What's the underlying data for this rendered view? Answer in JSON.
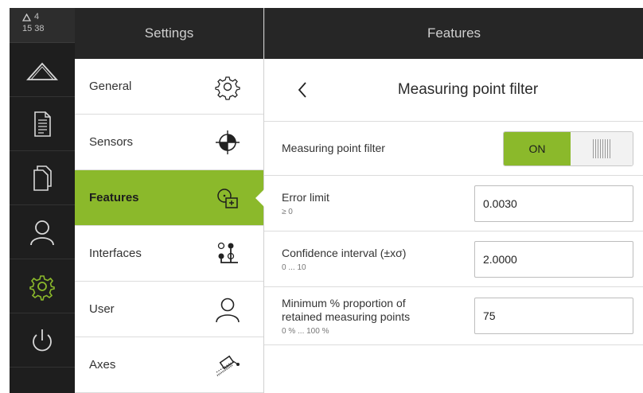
{
  "status": {
    "warning_count": "4",
    "time": "15 38"
  },
  "rail": {
    "items": [
      {
        "icon": "measure-icon"
      },
      {
        "icon": "protocol-icon"
      },
      {
        "icon": "file-management-icon"
      },
      {
        "icon": "user-login-icon"
      },
      {
        "icon": "settings-icon",
        "active": true
      },
      {
        "icon": "power-icon"
      }
    ]
  },
  "settings": {
    "header": "Settings",
    "items": [
      {
        "label": "General",
        "icon": "gear-icon"
      },
      {
        "label": "Sensors",
        "icon": "crosshair-sensor-icon"
      },
      {
        "label": "Features",
        "icon": "features-icon",
        "active": true
      },
      {
        "label": "Interfaces",
        "icon": "interfaces-icon"
      },
      {
        "label": "User",
        "icon": "user-icon"
      },
      {
        "label": "Axes",
        "icon": "axes-icon"
      }
    ]
  },
  "features": {
    "header": "Features",
    "title": "Measuring point filter",
    "rows": {
      "filter": {
        "label": "Measuring point filter",
        "toggle_on": "ON"
      },
      "error_limit": {
        "label": "Error limit",
        "range": "≥ 0",
        "value": "0.0030"
      },
      "confidence": {
        "label": "Confidence interval (±xσ)",
        "range": "0 ... 10",
        "value": "2.0000"
      },
      "proportion": {
        "label_line1": "Minimum % proportion of",
        "label_line2": "retained measuring points",
        "range": "0 % ... 100 %",
        "value": "75"
      }
    }
  },
  "colors": {
    "accent": "#8bb92b",
    "dark": "#1e1e1e",
    "header": "#262626"
  }
}
